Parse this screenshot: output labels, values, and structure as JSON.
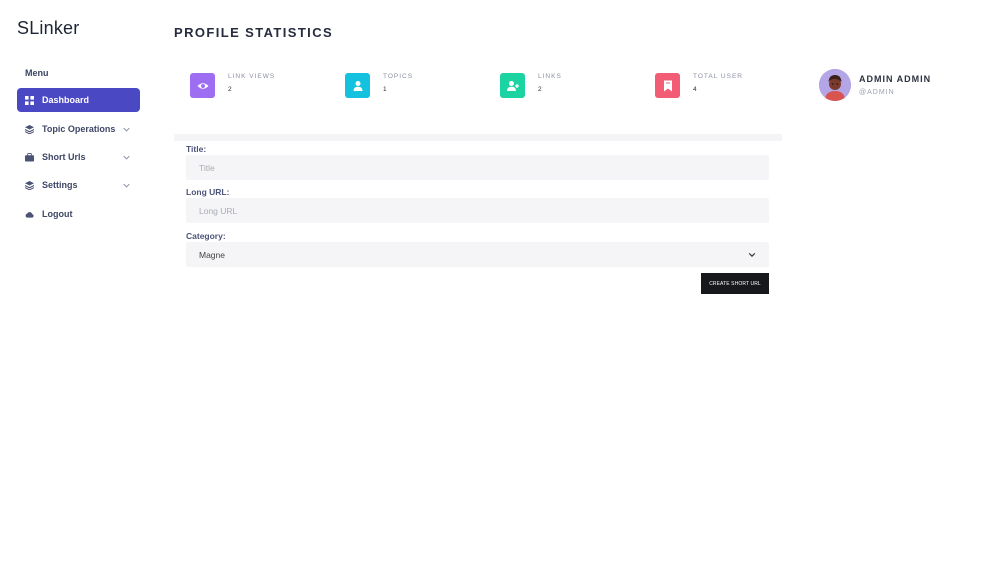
{
  "app": {
    "brand": "SLinker"
  },
  "sidebar": {
    "menu_title": "Menu",
    "items": [
      {
        "label": "Dashboard",
        "icon": "grid-icon"
      },
      {
        "label": "Topic Operations",
        "icon": "layers-icon"
      },
      {
        "label": "Short Urls",
        "icon": "briefcase-icon"
      },
      {
        "label": "Settings",
        "icon": "layers-icon"
      },
      {
        "label": "Logout",
        "icon": "cloud-icon"
      }
    ]
  },
  "header": {
    "title": "PROFILE STATISTICS"
  },
  "stats": [
    {
      "label": "LINK VIEWS",
      "value": "2",
      "color": "#9d6ef2",
      "icon": "eye-icon"
    },
    {
      "label": "TOPICS",
      "value": "1",
      "color": "#14c2e0",
      "icon": "user-icon"
    },
    {
      "label": "LINKS",
      "value": "2",
      "color": "#1cd3a2",
      "icon": "user-plus-icon"
    },
    {
      "label": "TOTAL USER",
      "value": "4",
      "color": "#f25c75",
      "icon": "bookmark-icon"
    }
  ],
  "profile": {
    "name": "ADMIN ADMIN",
    "handle": "@ADMIN"
  },
  "form": {
    "title_label": "Title:",
    "title_placeholder": "Title",
    "long_url_label": "Long URL:",
    "long_url_placeholder": "Long URL",
    "category_label": "Category:",
    "category_value": "Magne",
    "submit_label": "CREATE SHORT URL"
  },
  "colors": {
    "accent": "#4b48c4",
    "button": "#17181b"
  }
}
